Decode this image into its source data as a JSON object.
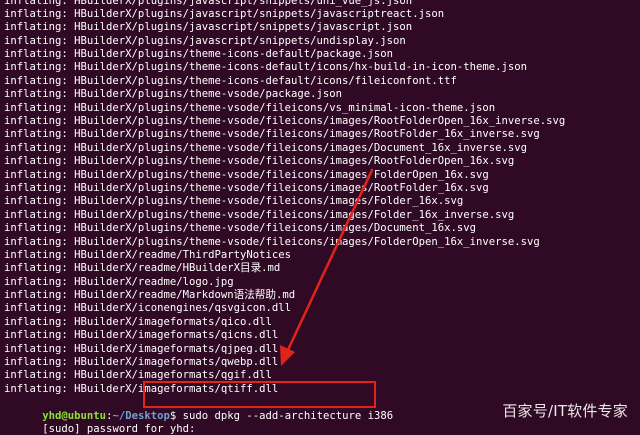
{
  "terminal": {
    "output_lines": [
      "inflating: HBuilderX/plugins/javascript/snippets/uni_vue_js.json",
      "inflating: HBuilderX/plugins/javascript/snippets/javascriptreact.json",
      "inflating: HBuilderX/plugins/javascript/snippets/javascript.json",
      "inflating: HBuilderX/plugins/javascript/snippets/undisplay.json",
      "inflating: HBuilderX/plugins/theme-icons-default/package.json",
      "inflating: HBuilderX/plugins/theme-icons-default/icons/hx-build-in-icon-theme.json",
      "inflating: HBuilderX/plugins/theme-icons-default/icons/fileiconfont.ttf",
      "inflating: HBuilderX/plugins/theme-vsode/package.json",
      "inflating: HBuilderX/plugins/theme-vsode/fileicons/vs_minimal-icon-theme.json",
      "inflating: HBuilderX/plugins/theme-vsode/fileicons/images/RootFolderOpen_16x_inverse.svg",
      "inflating: HBuilderX/plugins/theme-vsode/fileicons/images/RootFolder_16x_inverse.svg",
      "inflating: HBuilderX/plugins/theme-vsode/fileicons/images/Document_16x_inverse.svg",
      "inflating: HBuilderX/plugins/theme-vsode/fileicons/images/RootFolderOpen_16x.svg",
      "inflating: HBuilderX/plugins/theme-vsode/fileicons/images/FolderOpen_16x.svg",
      "inflating: HBuilderX/plugins/theme-vsode/fileicons/images/RootFolder_16x.svg",
      "inflating: HBuilderX/plugins/theme-vsode/fileicons/images/Folder_16x.svg",
      "inflating: HBuilderX/plugins/theme-vsode/fileicons/images/Folder_16x_inverse.svg",
      "inflating: HBuilderX/plugins/theme-vsode/fileicons/images/Document_16x.svg",
      "inflating: HBuilderX/plugins/theme-vsode/fileicons/images/FolderOpen_16x_inverse.svg",
      "inflating: HBuilderX/readme/ThirdPartyNotices",
      "inflating: HBuilderX/readme/HBuilderX目录.md",
      "inflating: HBuilderX/readme/logo.jpg",
      "inflating: HBuilderX/readme/Markdown语法帮助.md",
      "inflating: HBuilderX/iconengines/qsvgicon.dll",
      "inflating: HBuilderX/imageformats/qico.dll",
      "inflating: HBuilderX/imageformats/qicns.dll",
      "inflating: HBuilderX/imageformats/qjpeg.dll",
      "inflating: HBuilderX/imageformats/qwebp.dll",
      "inflating: HBuilderX/imageformats/qgif.dll",
      "inflating: HBuilderX/imageformats/qtiff.dll"
    ],
    "prompt_user": "yhd@ubuntu",
    "prompt_sep": ":",
    "prompt_path": "~/Desktop",
    "prompt_symbol": "$",
    "command": "sudo dpkg --add-architecture i386",
    "sudo_prompt": "[sudo] password for yhd:",
    "colors": {
      "background": "#300a24",
      "text": "#ffffff",
      "user": "#8ae234",
      "path": "#729fcf",
      "annotation": "#e2231a"
    }
  },
  "watermark": "百家号/IT软件专家"
}
